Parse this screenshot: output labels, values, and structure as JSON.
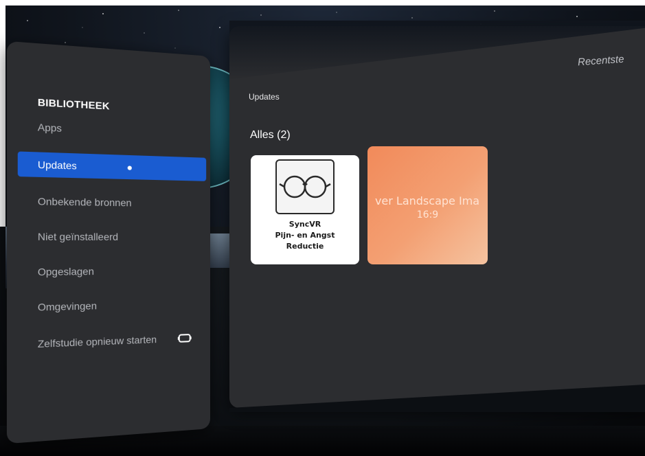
{
  "sidebar": {
    "title": "BIBLIOTHEEK",
    "items": [
      {
        "label": "Apps",
        "active": false
      },
      {
        "label": "Updates",
        "active": true
      },
      {
        "label": "Onbekende bronnen",
        "active": false
      },
      {
        "label": "Niet geïnstalleerd",
        "active": false
      },
      {
        "label": "Opgeslagen",
        "active": false
      },
      {
        "label": "Omgevingen",
        "active": false
      },
      {
        "label": "Zelfstudie opnieuw starten",
        "active": false,
        "icon": "headset-icon"
      }
    ]
  },
  "main": {
    "sort_label": "Recentste",
    "section_title": "Updates",
    "group_title": "Alles (2)",
    "tiles": [
      {
        "name": "SyncVR",
        "line2": "Pijn- en Angst",
        "line3": "Reductie",
        "icon": "glasses-icon"
      },
      {
        "title": "ver Landscape Ima",
        "subtitle": "16:9",
        "color": "#f28a5a"
      }
    ]
  },
  "colors": {
    "accent": "#1a5cd1",
    "panel": "#2c2d30"
  }
}
